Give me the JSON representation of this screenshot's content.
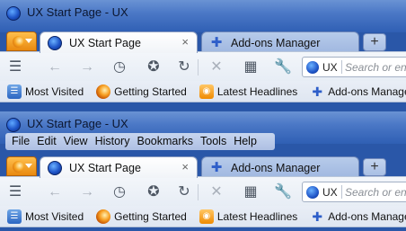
{
  "windows": [
    {
      "title": "UX Start Page - UX",
      "menubar": null,
      "tabs": [
        {
          "label": "UX Start Page",
          "active": true,
          "icon": "globe-icon"
        },
        {
          "label": "Add-ons Manager",
          "active": false,
          "icon": "puzzle-icon"
        }
      ],
      "urlbar": {
        "identity": "UX",
        "placeholder": "Search or ent"
      },
      "bookmarks": [
        {
          "label": "Most Visited",
          "icon": "most-visited-icon"
        },
        {
          "label": "Getting Started",
          "icon": "firefox-icon"
        },
        {
          "label": "Latest Headlines",
          "icon": "rss-icon"
        },
        {
          "label": "Add-ons Manager",
          "icon": "puzzle-icon"
        }
      ]
    },
    {
      "title": "UX Start Page - UX",
      "menubar": [
        "File",
        "Edit",
        "View",
        "History",
        "Bookmarks",
        "Tools",
        "Help"
      ],
      "tabs": [
        {
          "label": "UX Start Page",
          "active": true,
          "icon": "globe-icon"
        },
        {
          "label": "Add-ons Manager",
          "active": false,
          "icon": "puzzle-icon"
        }
      ],
      "urlbar": {
        "identity": "UX",
        "placeholder": "Search or ent"
      },
      "bookmarks": [
        {
          "label": "Most Visited",
          "icon": "most-visited-icon"
        },
        {
          "label": "Getting Started",
          "icon": "firefox-icon"
        },
        {
          "label": "Latest Headlines",
          "icon": "rss-icon"
        },
        {
          "label": "Add-ons Manager",
          "icon": "puzzle-icon"
        }
      ]
    }
  ],
  "colors": {
    "titlebar": "#4b78c6",
    "tab_active": "#ffffff",
    "tab_inactive": "#a9bfe4",
    "app_button": "#e8890f"
  },
  "close_glyph": "×",
  "newtab_glyph": "+"
}
